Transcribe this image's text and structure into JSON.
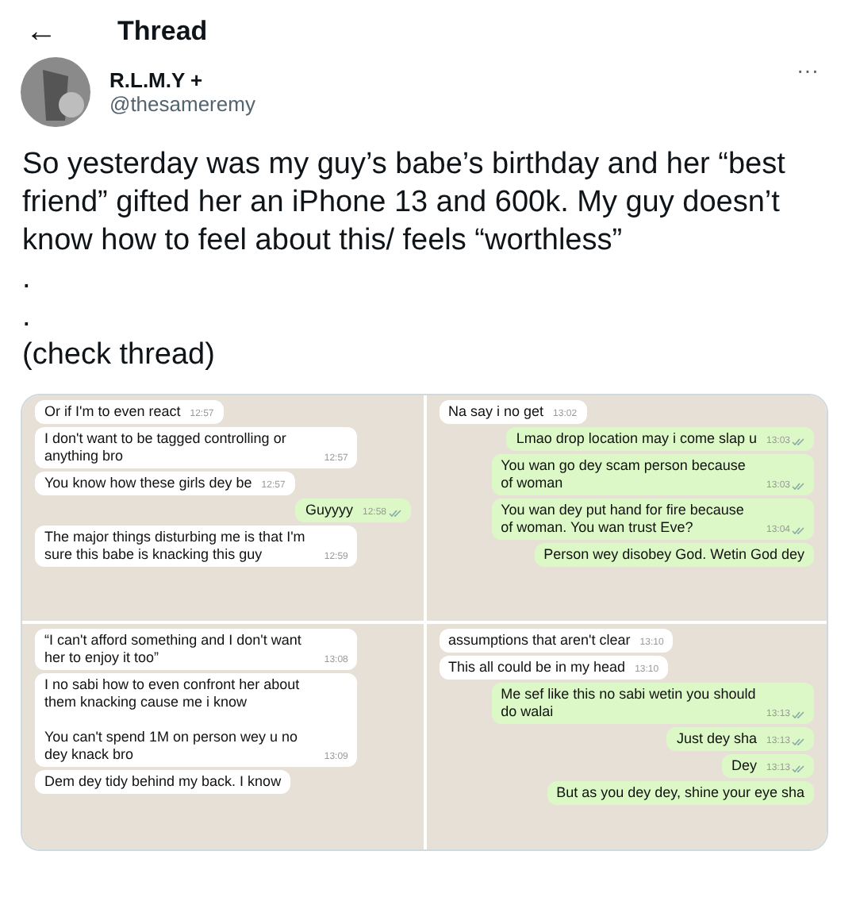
{
  "header": {
    "back": "←",
    "title": "Thread"
  },
  "author": {
    "name": "R.L.M.Y +",
    "handle": "@thesameremy",
    "more": "···"
  },
  "tweet_text": [
    "So yesterday was my guy’s babe’s birthday and her “best friend” gifted her an iPhone 13 and 600k. My guy doesn’t know how to feel about this/ feels “worthless”",
    ".",
    ".",
    "(check thread)"
  ],
  "chat_panels": [
    {
      "messages": [
        {
          "kind": "in",
          "text": "Or if I'm to even react",
          "time": "12:57"
        },
        {
          "kind": "in",
          "text": "I don't want to be tagged controlling or anything bro",
          "time": "12:57"
        },
        {
          "kind": "in",
          "text": "You know how these girls dey be",
          "time": "12:57"
        },
        {
          "kind": "out",
          "text": "Guyyyy",
          "time": "12:58"
        },
        {
          "kind": "in",
          "text": "The major things disturbing me is that I'm sure this babe is knacking this guy",
          "time": "12:59"
        }
      ]
    },
    {
      "messages": [
        {
          "kind": "in",
          "text": "Na say i no get",
          "time": "13:02"
        },
        {
          "kind": "out",
          "text": "Lmao drop location may i come slap u",
          "time": "13:03"
        },
        {
          "kind": "out",
          "text": "You wan go dey scam person because of woman",
          "time": "13:03"
        },
        {
          "kind": "out",
          "text": "You wan dey put hand for fire because of woman. You wan trust Eve?",
          "time": "13:04"
        },
        {
          "kind": "out",
          "text": "Person wey disobey God. Wetin God dey"
        }
      ]
    },
    {
      "messages": [
        {
          "kind": "in",
          "text": "“I can't afford something and I don't want her to enjoy it too”",
          "time": "13:08"
        },
        {
          "kind": "in",
          "text": "I no sabi how to even confront her about them knacking cause me i know\n\nYou can't spend 1M on person wey u no dey knack bro",
          "time": "13:09"
        },
        {
          "kind": "in",
          "text": "Dem dey tidy behind my back. I know"
        }
      ]
    },
    {
      "messages": [
        {
          "kind": "in",
          "text": "assumptions that aren't clear",
          "time": "13:10"
        },
        {
          "kind": "in",
          "text": "This all could be in my head",
          "time": "13:10"
        },
        {
          "kind": "out",
          "text": "Me sef like this no sabi wetin you should do walai",
          "time": "13:13"
        },
        {
          "kind": "out",
          "text": "Just dey sha",
          "time": "13:13"
        },
        {
          "kind": "out",
          "text": "Dey",
          "time": "13:13"
        },
        {
          "kind": "out",
          "text": "But as you dey dey, shine your eye sha"
        }
      ]
    }
  ]
}
